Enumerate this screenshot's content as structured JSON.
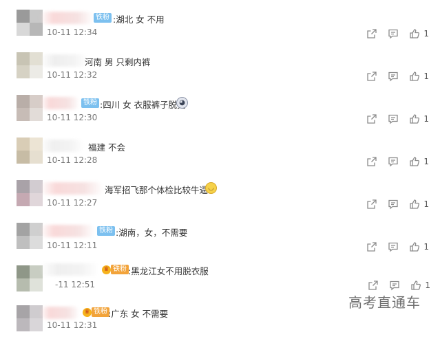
{
  "comments": [
    {
      "badge": "铁粉",
      "text": ":湖北 女 不用",
      "time": "10-11 12:34",
      "likes": "1"
    },
    {
      "badge": "",
      "text": "河南 男 只剩内裤",
      "time": "10-11 12:32",
      "likes": "1"
    },
    {
      "badge": "铁粉",
      "text": ":四川 女 衣服裤子脱完",
      "time": "10-11 12:30",
      "likes": "1"
    },
    {
      "badge": "",
      "text": "福建 不会",
      "time": "10-11 12:28",
      "likes": "1"
    },
    {
      "badge": "",
      "text": "海军招飞那个体检比较牛逼",
      "time": "10-11 12:27",
      "likes": "1"
    },
    {
      "badge": "铁粉",
      "text": ":湖南，女，不需要",
      "time": "10-11 12:11",
      "likes": "1"
    },
    {
      "badge": "铁粉",
      "text": ":黑龙江女不用脱衣服",
      "time": "-11 12:51",
      "likes": "1"
    },
    {
      "badge": "铁粉",
      "text": ":广东 女 不需要",
      "time": "10-11 12:31",
      "likes": ""
    }
  ],
  "icons": {
    "share": "share-icon",
    "comment": "comment-icon",
    "like": "thumbs-up-icon",
    "crown": "crown-icon"
  },
  "watermark": "高考直通车",
  "colors": {
    "badge_blue": "#7cc0ef",
    "badge_gold": "#f2a33a",
    "text": "#333333",
    "time": "#777777",
    "icon": "#8a8a8a"
  }
}
